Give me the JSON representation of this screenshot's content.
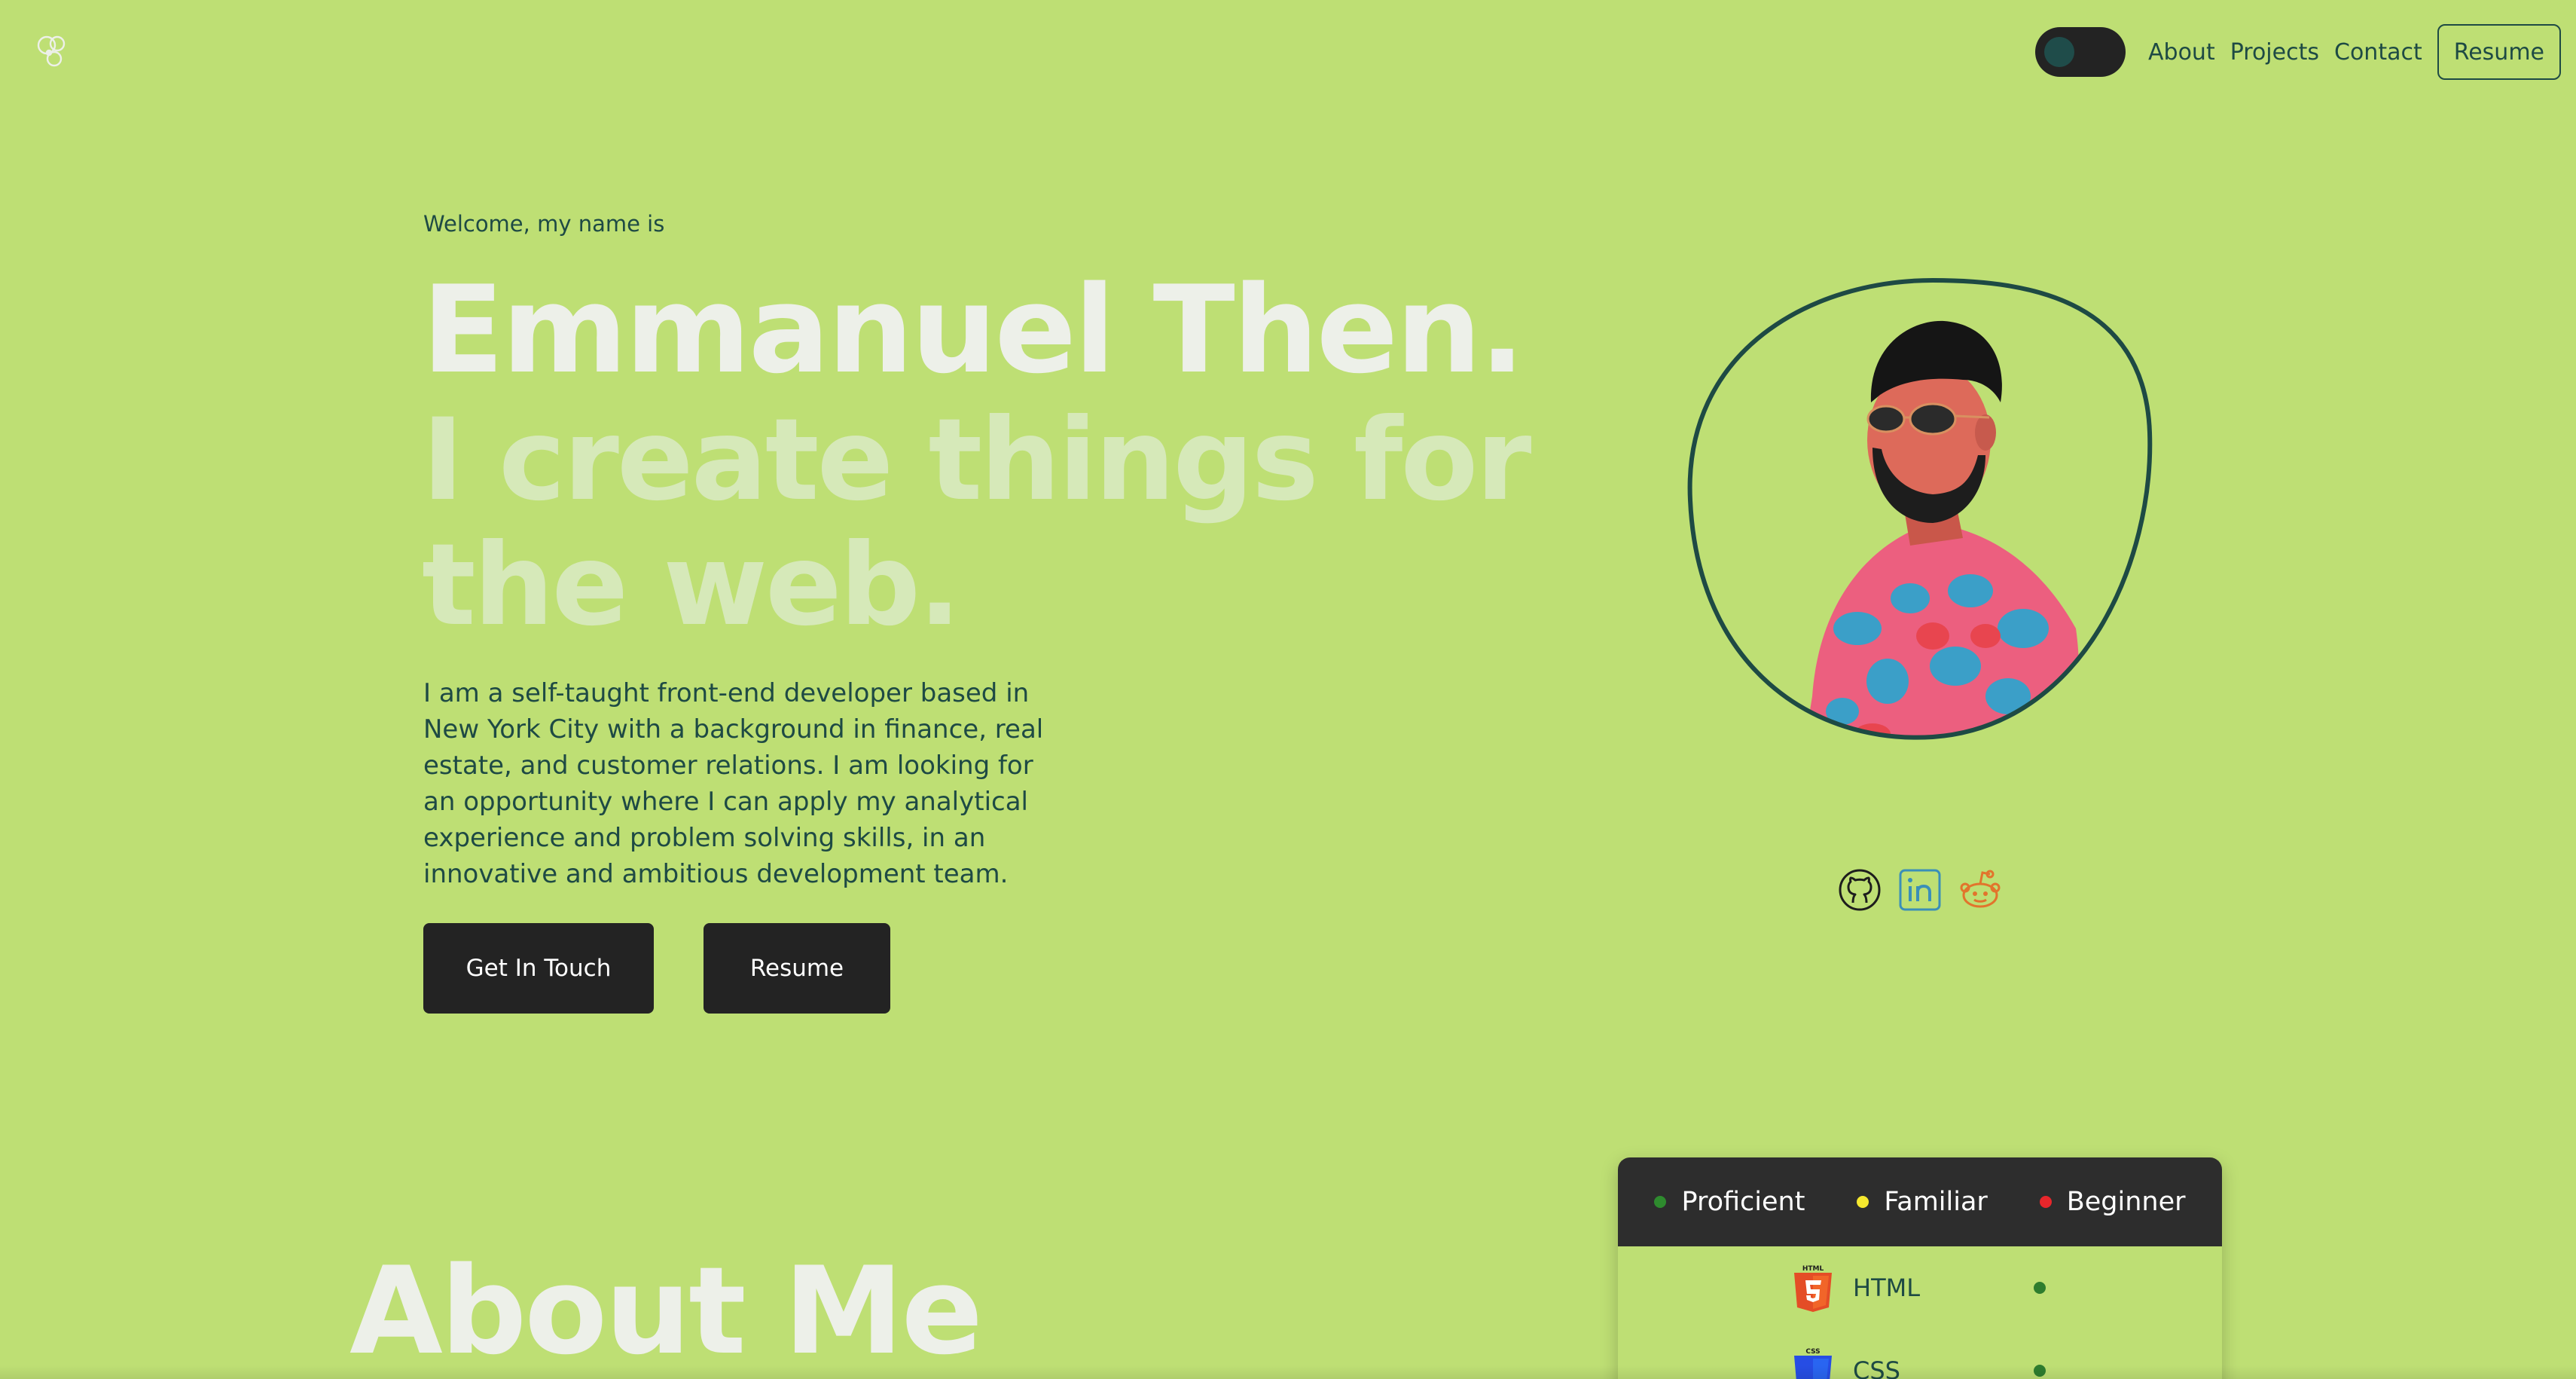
{
  "nav": {
    "logo_icon": "atom-logo-icon",
    "theme_toggle_icon": "theme-toggle-icon",
    "links": [
      "About",
      "Projects",
      "Contact"
    ],
    "resume_label": "Resume"
  },
  "hero": {
    "welcome": "Welcome, my name is",
    "name": "Emmanuel Then.",
    "tagline": "I create things for the web.",
    "bio": "I am a self-taught front-end developer based in New York City with a background in finance, real estate, and customer relations. I am looking for an opportunity where I can apply my analytical experience and problem solving skills, in an innovative and ambitious development team.",
    "cta_primary": "Get In Touch",
    "cta_secondary": "Resume"
  },
  "social": [
    {
      "icon": "github-icon"
    },
    {
      "icon": "linkedin-icon"
    },
    {
      "icon": "reddit-icon"
    }
  ],
  "about": {
    "title": "About Me"
  },
  "skills": {
    "legend": [
      {
        "label": "Proficient",
        "color": "#2e8b2e"
      },
      {
        "label": "Familiar",
        "color": "#f5e82e"
      },
      {
        "label": "Beginner",
        "color": "#e8262b"
      }
    ],
    "items": [
      {
        "name": "HTML",
        "icon": "html5-icon",
        "level": "Proficient",
        "color": "#2e7d2e"
      },
      {
        "name": "CSS",
        "icon": "css3-icon",
        "level": "Proficient",
        "color": "#2e7d2e"
      }
    ]
  },
  "colors": {
    "background": "#bedf74",
    "accent_dark": "#1e4a44",
    "button_bg": "#232323"
  }
}
